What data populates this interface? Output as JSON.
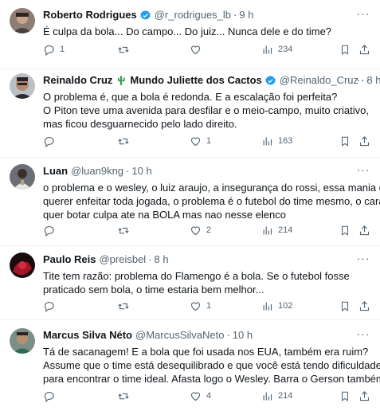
{
  "tweets": [
    {
      "name": "Roberto Rodrigues",
      "handle": "@r_rodrigues_lb",
      "time": "9 h",
      "lines": [
        "É culpa da bola... Do campo... Do juiz... Nunca dele e do time?"
      ],
      "replies": "1",
      "retweets": "",
      "likes": "",
      "views": "234"
    },
    {
      "name": "Reinaldo Cruz",
      "name_suffix": "Mundo Juliette dos Cactos",
      "handle": "@Reinaldo_Cruz",
      "time": "8 h",
      "lines": [
        "O problema é, que a bola é redonda. E a escalação foi perfeita?",
        "O Piton teve uma avenida para desfilar e o meio-campo, muito criativo,",
        "mas ficou desguarnecido pelo lado direito."
      ],
      "replies": "",
      "retweets": "",
      "likes": "1",
      "views": "163"
    },
    {
      "name": "Luan",
      "handle": "@luan9kng",
      "time": "10 h",
      "lines": [
        "o problema e o wesley, o luiz araujo, a insegurança do rossi, essa mania de",
        "querer enfeitar toda jogada, o problema é o futebol do time mesmo, o cara",
        "quer botar culpa ate na BOLA mas nao nesse elenco"
      ],
      "replies": "",
      "retweets": "",
      "likes": "2",
      "views": "214"
    },
    {
      "name": "Paulo Reis",
      "handle": "@preisbel",
      "time": "8 h",
      "lines": [
        "Tite tem razão: problema do Flamengo é a bola. Se o futebol fosse",
        "praticado sem bola, o time estaria bem melhor..."
      ],
      "replies": "",
      "retweets": "",
      "likes": "1",
      "views": "102"
    },
    {
      "name": "Marcus Silva Néto",
      "handle": "@MarcusSilvaNeto",
      "time": "10 h",
      "lines": [
        "Tá de sacanagem! E a bola que foi usada nos EUA, também era ruim?",
        "Assume que o time está desequilibrado e que você está tendo dificuldade",
        "para encontrar o time ideal. Afasta logo o Wesley. Barra o Gerson também."
      ],
      "replies": "",
      "retweets": "",
      "likes": "4",
      "views": "214"
    }
  ],
  "colors": {
    "text": "#0f1419",
    "secondary": "#536471",
    "verified": "#1d9bf0",
    "divider": "#eff3f4",
    "cactus": "#3a9d4c"
  }
}
